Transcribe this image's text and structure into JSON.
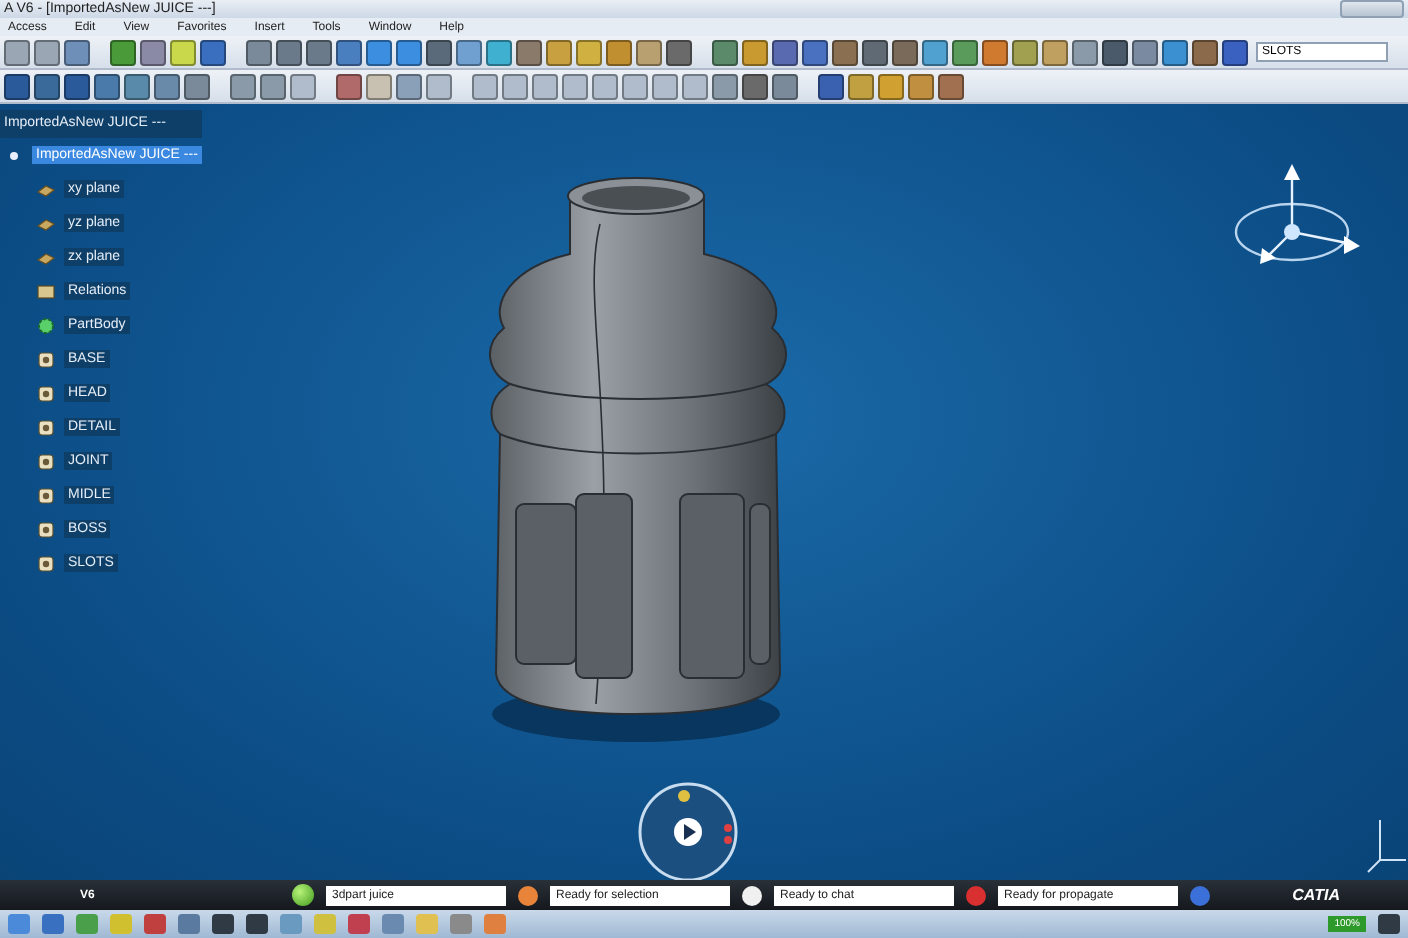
{
  "window": {
    "title": "A V6 - [ImportedAsNew JUICE ---]"
  },
  "menu": [
    "Access",
    "Edit",
    "View",
    "Favorites",
    "Insert",
    "Tools",
    "Window",
    "Help"
  ],
  "search": {
    "value": "SLOTS"
  },
  "tree": {
    "root": "ImportedAsNew JUICE ---",
    "children": [
      {
        "label": "ImportedAsNew JUICE ---",
        "kind": "product",
        "selected": true,
        "children": [
          {
            "label": "xy plane",
            "kind": "plane",
            "selected": false
          },
          {
            "label": "yz plane",
            "kind": "plane",
            "selected": false
          },
          {
            "label": "zx plane",
            "kind": "plane",
            "selected": false
          },
          {
            "label": "Relations",
            "kind": "relations",
            "selected": false
          },
          {
            "label": "PartBody",
            "kind": "body",
            "selected": false
          },
          {
            "label": "BASE",
            "kind": "set",
            "selected": false
          },
          {
            "label": "HEAD",
            "kind": "set",
            "selected": false
          },
          {
            "label": "DETAIL",
            "kind": "set",
            "selected": false
          },
          {
            "label": "JOINT",
            "kind": "set",
            "selected": false
          },
          {
            "label": "MIDLE",
            "kind": "set",
            "selected": false
          },
          {
            "label": "BOSS",
            "kind": "set",
            "selected": false
          },
          {
            "label": "SLOTS",
            "kind": "set",
            "selected": false
          }
        ]
      }
    ]
  },
  "status_bar": {
    "app": "V6",
    "fields": [
      "3dpart juice",
      "Ready for selection",
      "Ready to chat",
      "Ready for propagate"
    ],
    "brand": "CATIA"
  },
  "taskbar": {
    "battery": "100%"
  }
}
